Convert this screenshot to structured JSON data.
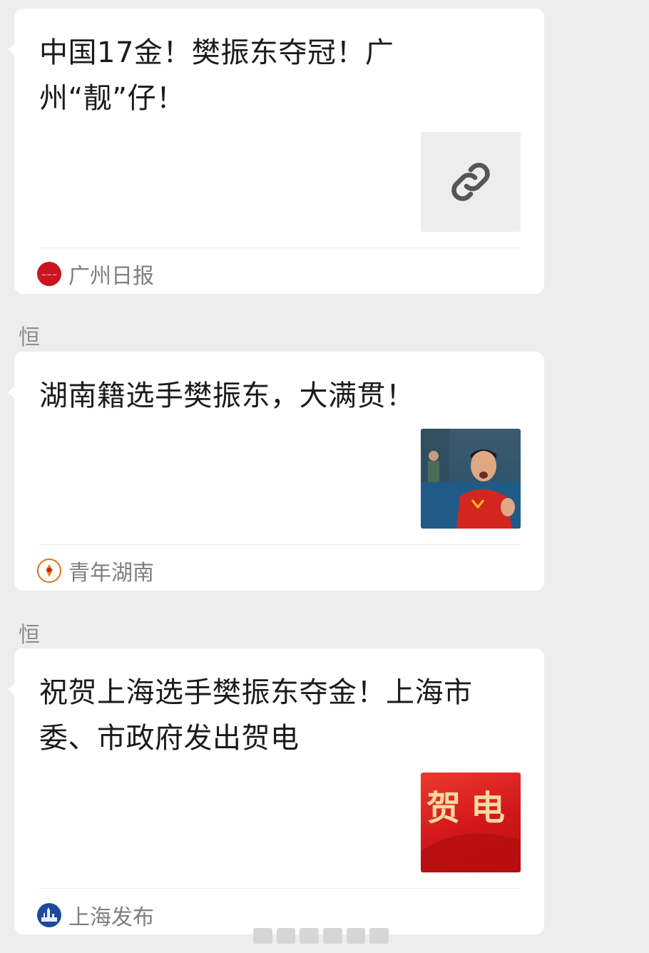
{
  "messages": [
    {
      "title": "中国17金！樊振东夺冠！广州“靓”仔！",
      "thumbnail": "link-icon",
      "source": "广州日报",
      "source_logo": "guangzhou-daily-logo"
    },
    {
      "sender": "恒",
      "title": "湖南籍选手樊振东，大满贯！",
      "thumbnail": "player-photo",
      "source": "青年湖南",
      "source_logo": "youth-hunan-logo"
    },
    {
      "sender": "恒",
      "title": "祝贺上海选手樊振东夺金！上海市委、市政府发出贺电",
      "thumbnail_text": "贺电",
      "source": "上海发布",
      "source_logo": "shanghai-release-logo"
    }
  ],
  "colors": {
    "background": "#ededed",
    "card": "#ffffff",
    "source_text": "#7f7f7f"
  }
}
